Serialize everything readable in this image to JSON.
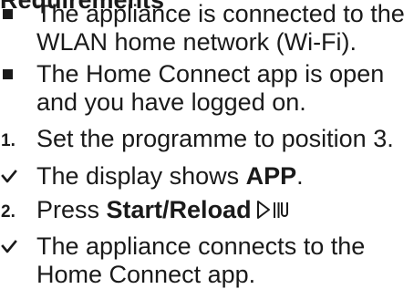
{
  "heading": "Requirements",
  "requirements": [
    {
      "line1": "The appliance is connected to the",
      "line2": "WLAN home network (Wi-Fi)."
    },
    {
      "line1": "The Home Connect app is open",
      "line2": "and you have logged on."
    }
  ],
  "steps": {
    "step1": {
      "number": "1.",
      "text": "Set the programme to position 3."
    },
    "result1": {
      "prefix": "The display shows ",
      "bold": "APP",
      "suffix": "."
    },
    "step2": {
      "number": "2.",
      "prefix": "Press ",
      "bold": "Start/Reload",
      "icon": "start-reload-icon"
    },
    "result2": {
      "line1": "The appliance connects to the",
      "line2": "Home Connect app."
    }
  },
  "icons": {
    "bullet": "square-bullet-icon",
    "result": "checkmark-icon"
  },
  "colors": {
    "text": "#1a1a1a",
    "background": "#ffffff"
  }
}
